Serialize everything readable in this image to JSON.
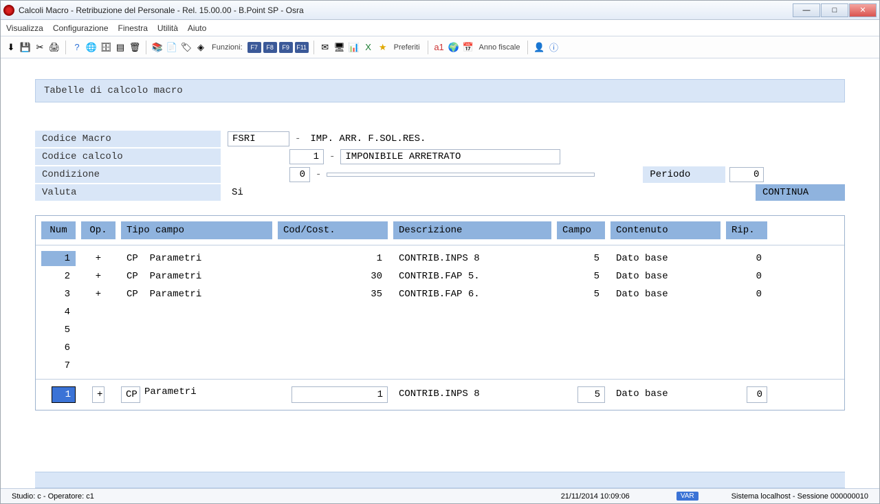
{
  "window": {
    "title": "Calcoli Macro - Retribuzione del Personale - Rel. 15.00.00 - B.Point SP - Osra"
  },
  "menu": {
    "items": [
      "Visualizza",
      "Configurazione",
      "Finestra",
      "Utilità",
      "Aiuto"
    ]
  },
  "toolbar": {
    "funzioni_label": "Funzioni:",
    "fkeys": [
      "F7",
      "F8",
      "F9",
      "F11"
    ],
    "preferiti": "Preferiti",
    "anno_fiscale": "Anno fiscale"
  },
  "section_title": "Tabelle di calcolo macro",
  "form": {
    "codice_macro_label": "Codice Macro",
    "codice_macro_value": "FSRI",
    "codice_macro_desc": "IMP. ARR. F.SOL.RES.",
    "codice_calcolo_label": "Codice calcolo",
    "codice_calcolo_value": "1",
    "codice_calcolo_desc": "IMPONIBILE ARRETRATO",
    "condizione_label": "Condizione",
    "condizione_value": "0",
    "periodo_label": "Periodo",
    "periodo_value": "0",
    "valuta_label": "Valuta",
    "valuta_value": "Si",
    "continua": "CONTINUA"
  },
  "table": {
    "headers": {
      "num": "Num",
      "op": "Op.",
      "tipo": "Tipo campo",
      "cod": "Cod/Cost.",
      "desc": "Descrizione",
      "campo": "Campo",
      "cont": "Contenuto",
      "rip": "Rip."
    },
    "rows": [
      {
        "num": "1",
        "op": "+",
        "tipo_code": "CP",
        "tipo": "Parametri",
        "cod": "1",
        "desc": "CONTRIB.INPS 8",
        "campo": "5",
        "cont": "Dato base",
        "rip": "0"
      },
      {
        "num": "2",
        "op": "+",
        "tipo_code": "CP",
        "tipo": "Parametri",
        "cod": "30",
        "desc": "CONTRIB.FAP 5.",
        "campo": "5",
        "cont": "Dato base",
        "rip": "0"
      },
      {
        "num": "3",
        "op": "+",
        "tipo_code": "CP",
        "tipo": "Parametri",
        "cod": "35",
        "desc": "CONTRIB.FAP 6.",
        "campo": "5",
        "cont": "Dato base",
        "rip": "0"
      },
      {
        "num": "4",
        "op": "",
        "tipo_code": "",
        "tipo": "",
        "cod": "",
        "desc": "",
        "campo": "",
        "cont": "",
        "rip": ""
      },
      {
        "num": "5",
        "op": "",
        "tipo_code": "",
        "tipo": "",
        "cod": "",
        "desc": "",
        "campo": "",
        "cont": "",
        "rip": ""
      },
      {
        "num": "6",
        "op": "",
        "tipo_code": "",
        "tipo": "",
        "cod": "",
        "desc": "",
        "campo": "",
        "cont": "",
        "rip": ""
      },
      {
        "num": "7",
        "op": "",
        "tipo_code": "",
        "tipo": "",
        "cod": "",
        "desc": "",
        "campo": "",
        "cont": "",
        "rip": ""
      }
    ],
    "edit": {
      "num": "1",
      "op": "+",
      "tipo_code": "CP",
      "tipo": "Parametri",
      "cod": "1",
      "desc": "CONTRIB.INPS 8",
      "campo": "5",
      "cont": "Dato base",
      "rip": "0"
    }
  },
  "status": {
    "studio": "Studio: c - Operatore: c1",
    "datetime": "21/11/2014  10:09:06",
    "var": "VAR",
    "session": "Sistema localhost - Sessione 000000010"
  }
}
